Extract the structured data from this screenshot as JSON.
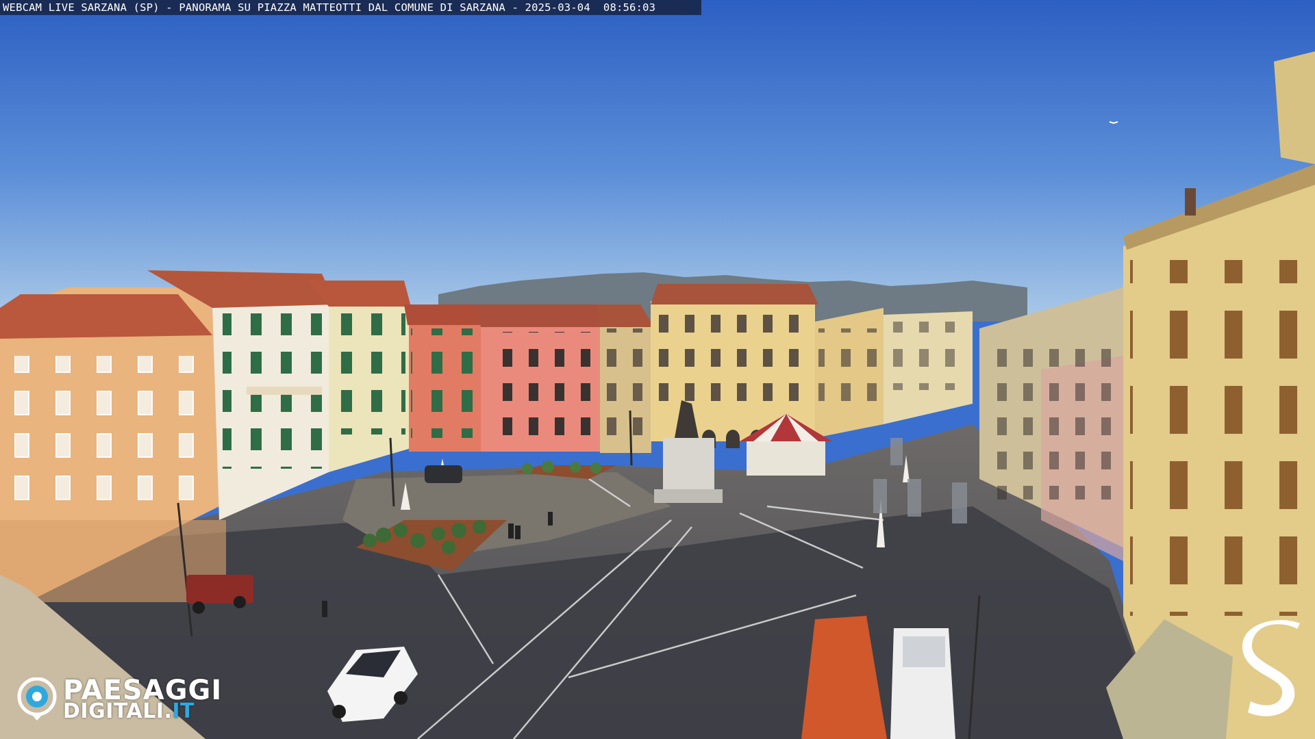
{
  "overlay": {
    "caption": "WEBCAM LIVE SARZANA (SP) - PANORAMA SU PIAZZA MATTEOTTI DAL COMUNE DI SARZANA - 2025-03-04  08:56:03"
  },
  "logo": {
    "line1": "PAESAGGI",
    "line2_main": "DIGITALI",
    "line2_dot": ".",
    "line2_tld": "IT",
    "icon": "eye-camera-icon"
  },
  "watermark": {
    "icon": "s-logo-icon"
  },
  "colors": {
    "sky_top": "#2f63c4",
    "sky_bottom": "#9fc3e6",
    "pavement": "#4d4f57",
    "shadow": "#2f3036",
    "orange_building": "#e9b37c",
    "red_building": "#e27a62",
    "yellow_building": "#e8cf8b",
    "roof": "#b8573b",
    "logo_blue": "#2fa8e0"
  }
}
